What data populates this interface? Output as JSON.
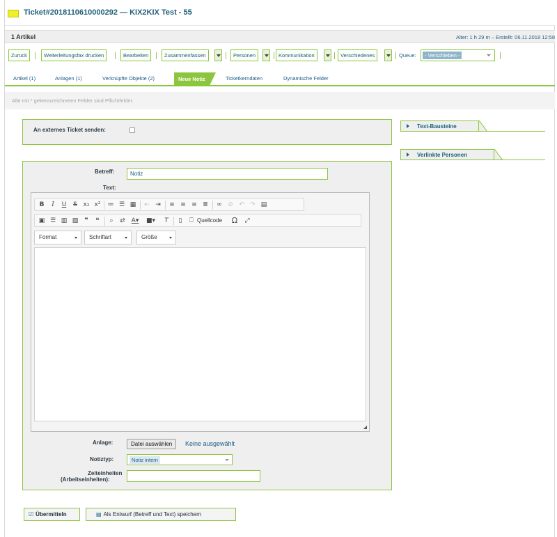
{
  "ticket": {
    "title": "Ticket#2018110610000292 — KIX2KIX Test - 55",
    "flag_color": "#f0ef2a"
  },
  "article_bar": {
    "count": "1 Artikel",
    "meta": "Alter: 1 h 29 m – Erstellt: 06.11.2018 12:58"
  },
  "toolbar": {
    "back": "Zurück",
    "fax": "Weiterleitungsfax drucken",
    "edit": "Bearbeiten",
    "merge": "Zusammenfassen",
    "people": "Personen",
    "communication": "Kommunikation",
    "misc": "Verschiedenes",
    "queue_label": "Queue:",
    "queue_value": "- Verschieben -"
  },
  "tabs": [
    {
      "label": "Artikel (1)"
    },
    {
      "label": "Anlagen (1)"
    },
    {
      "label": "Verknüpfte Objekte (2)"
    },
    {
      "label": "Neue Notiz"
    },
    {
      "label": "Ticketkerndaten"
    },
    {
      "label": "Dynamische Felder"
    }
  ],
  "active_tab": "Neue Notiz",
  "required_hint": "Alle mit * gekennzeichneten Felder sind Pflichtfelder.",
  "form": {
    "external_label": "An externes Ticket senden:",
    "external_checked": false,
    "subject_label": "Betreff:",
    "subject_value": "Notiz",
    "text_label": "Text:",
    "editor": {
      "format": "Format",
      "font": "Schriftart",
      "size": "Größe",
      "source": "Quellcode"
    },
    "attachment_label": "Anlage:",
    "file_button": "Datei auswählen",
    "file_status": "Keine ausgewählt",
    "note_type_label": "Notiztyp:",
    "note_type_value": "Notiz intern",
    "time_label_1": "Zeiteinheiten",
    "time_label_2": "(Arbeitseinheiten):",
    "time_value": ""
  },
  "actions": {
    "submit": "Übermitteln",
    "draft": "Als Entwurf (Betreff und Text) speichern"
  },
  "sidebar": {
    "text_modules": "Text-Bausteine",
    "linked_persons": "Verlinkte Personen"
  },
  "colors": {
    "accent": "#8cc63f",
    "link": "#1a5c86"
  }
}
